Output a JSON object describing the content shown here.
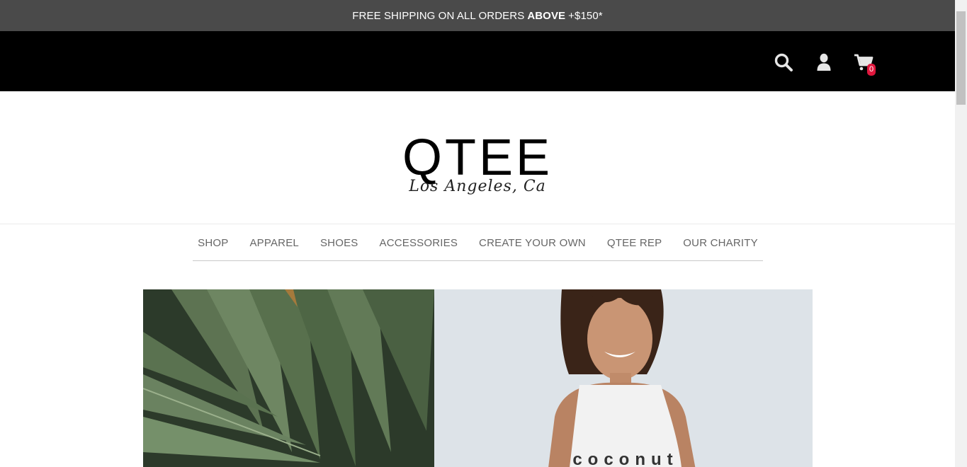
{
  "announcement": {
    "prefix": "FREE SHIPPING ON ALL ORDERS",
    "emphasis": "ABOVE",
    "suffix": "+$150*"
  },
  "header": {
    "icons": [
      "search-icon",
      "user-icon",
      "cart-icon"
    ],
    "cart_count": "0",
    "badge_color": "#e0173d"
  },
  "logo": {
    "wordmark": "QTEE",
    "tagline": "Los Angeles, Ca"
  },
  "nav": {
    "items": [
      "SHOP",
      "APPAREL",
      "SHOES",
      "ACCESSORIES",
      "CREATE YOUR OWN",
      "QTEE REP",
      "OUR CHARITY"
    ]
  },
  "hero": {
    "shirt_text": "coconut"
  }
}
